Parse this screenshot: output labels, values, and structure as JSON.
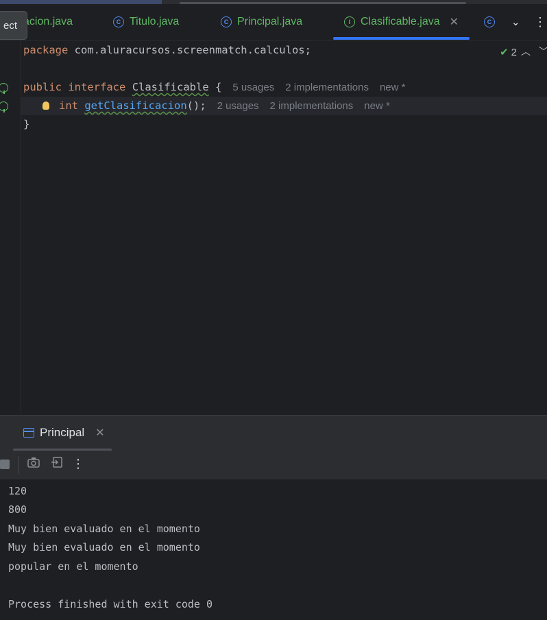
{
  "tabs": [
    {
      "label": "acion.java",
      "icon": "class-icon",
      "active": false
    },
    {
      "label": "Titulo.java",
      "icon": "class-icon",
      "active": false
    },
    {
      "label": "Principal.java",
      "icon": "runnable-class-icon",
      "active": false
    },
    {
      "label": "Clasificable.java",
      "icon": "interface-icon",
      "active": true
    },
    {
      "label": "",
      "icon": "class-icon",
      "active": false
    }
  ],
  "project_popup": {
    "label": "ect"
  },
  "editor": {
    "lines": [
      {
        "package_kw": "package",
        "package_name": " com.aluracursos.screenmatch.calculos;"
      },
      {},
      {
        "kw1": "public",
        "kw2": "interface",
        "name": "Clasificable",
        "rest": " {",
        "usages": "5 usages",
        "impls": "2 implementations",
        "new": "new *"
      },
      {
        "type": "int",
        "method": "getClasificacion",
        "rest": "();",
        "usages": "2 usages",
        "impls": "2 implementations",
        "new": "new *"
      },
      {
        "text": "}"
      }
    ],
    "inspection_count": "2",
    "colors": {
      "keyword": "#cf8e6d",
      "method": "#56a8f5",
      "hint": "#7a7e85"
    }
  },
  "run_panel": {
    "tab_label": "Principal",
    "output": [
      "120",
      "800",
      "Muy bien evaluado en el momento",
      "Muy bien evaluado en el momento",
      "popular en el momento",
      "",
      "Process finished with exit code 0"
    ]
  }
}
